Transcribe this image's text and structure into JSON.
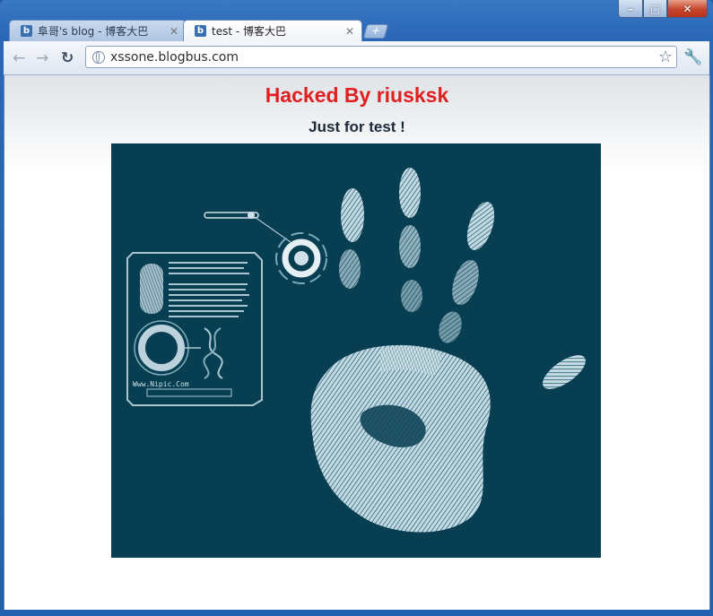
{
  "window": {
    "controls": {
      "minimize": "–",
      "maximize": "□",
      "close": "✕"
    }
  },
  "tabs": [
    {
      "title": "阜哥's blog - 博客大巴",
      "favicon": "b",
      "active": false
    },
    {
      "title": "test - 博客大巴",
      "favicon": "b",
      "active": true
    }
  ],
  "toolbar": {
    "url": "xssone.blogbus.com",
    "icons": [
      "back-arrow-icon",
      "forward-arrow-icon",
      "reload-icon",
      "globe-icon",
      "star-icon",
      "wrench-icon"
    ]
  },
  "page": {
    "title": "Hacked By riusksk",
    "subtitle": "Just for test !",
    "image": {
      "background_color": "#073e52",
      "watermark": "Www.Nipic.Com"
    },
    "colors": {
      "title": "#e02020",
      "subtitle": "#1c2a3a"
    }
  }
}
